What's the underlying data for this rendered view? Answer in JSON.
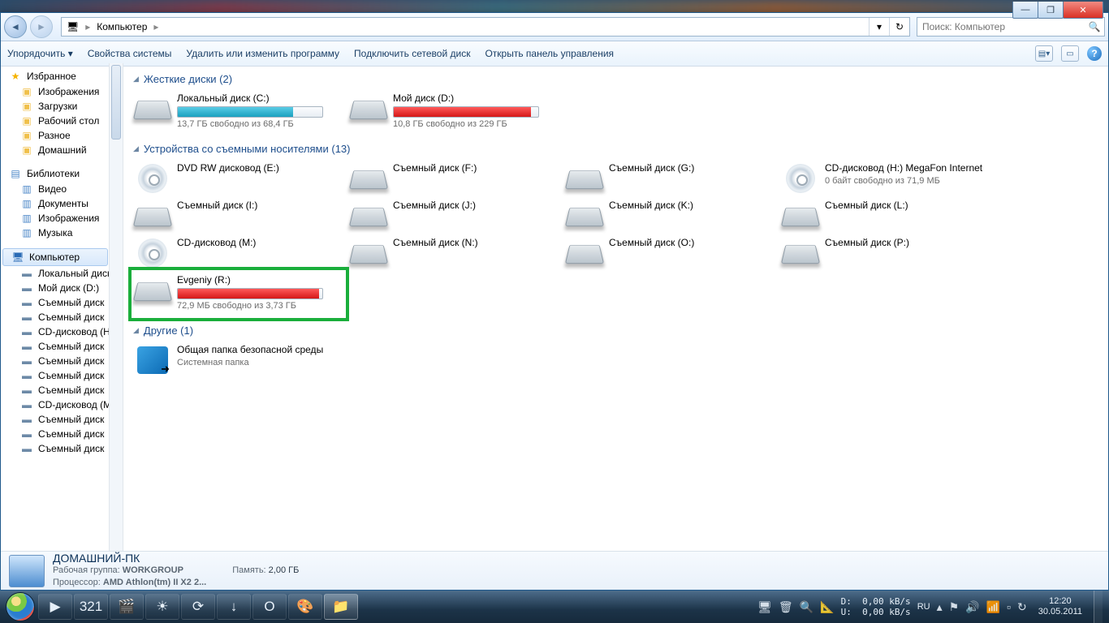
{
  "window_controls": {
    "min": "—",
    "max": "❐",
    "close": "✕"
  },
  "breadcrumb": {
    "icon": "🖥",
    "root": "Компьютер",
    "sep": "▸",
    "refresh": "↻",
    "dropdown": "▾"
  },
  "search": {
    "placeholder": "Поиск: Компьютер",
    "icon": "🔍"
  },
  "toolbar": {
    "organize": "Упорядочить ▾",
    "sysprops": "Свойства системы",
    "uninstall": "Удалить или изменить программу",
    "mapnet": "Подключить сетевой диск",
    "ctrlpanel": "Открыть панель управления",
    "viewicon": "▤▾",
    "previewicon": "▭",
    "help": "?"
  },
  "sidebar": {
    "favorites": {
      "head": "Избранное",
      "items": [
        "Изображения",
        "Загрузки",
        "Рабочий стол",
        "Разное",
        "Домашний"
      ]
    },
    "libraries": {
      "head": "Библиотеки",
      "items": [
        "Видео",
        "Документы",
        "Изображения",
        "Музыка"
      ]
    },
    "computer": {
      "head": "Компьютер",
      "items": [
        "Локальный диск",
        "Мой диск (D:)",
        "Съемный диск",
        "Съемный диск",
        "CD-дисковод (H",
        "Съемный диск",
        "Съемный диск",
        "Съемный диск",
        "Съемный диск",
        "CD-дисковод (M",
        "Съемный диск",
        "Съемный диск",
        "Съемный диск"
      ]
    }
  },
  "sections": {
    "hdd": {
      "title": "Жесткие диски (2)",
      "tri": "◢"
    },
    "removable": {
      "title": "Устройства со съемными носителями (13)",
      "tri": "◢"
    },
    "other": {
      "title": "Другие (1)",
      "tri": "◢"
    }
  },
  "hdd": [
    {
      "name": "Локальный диск (C:)",
      "space": "13,7 ГБ свободно из 68,4 ГБ",
      "fill": 80,
      "color": "teal"
    },
    {
      "name": "Мой диск (D:)",
      "space": "10,8 ГБ свободно из 229 ГБ",
      "fill": 95,
      "color": "red"
    }
  ],
  "removable": [
    {
      "name": "DVD RW дисковод (E:)",
      "type": "dvd"
    },
    {
      "name": "Съемный диск (F:)",
      "type": "hdd"
    },
    {
      "name": "Съемный диск (G:)",
      "type": "hdd"
    },
    {
      "name": "CD-дисковод (H:) MegaFon Internet",
      "type": "dvd",
      "space": "0 байт свободно из 71,9 МБ"
    },
    {
      "name": "Съемный диск (I:)",
      "type": "hdd"
    },
    {
      "name": "Съемный диск (J:)",
      "type": "hdd"
    },
    {
      "name": "Съемный диск (K:)",
      "type": "hdd"
    },
    {
      "name": "Съемный диск (L:)",
      "type": "hdd"
    },
    {
      "name": "CD-дисковод (M:)",
      "type": "dvd"
    },
    {
      "name": "Съемный диск (N:)",
      "type": "hdd"
    },
    {
      "name": "Съемный диск (O:)",
      "type": "hdd"
    },
    {
      "name": "Съемный диск (P:)",
      "type": "hdd"
    },
    {
      "name": "Evgeniy (R:)",
      "type": "hdd",
      "space": "72,9 МБ свободно из 3,73 ГБ",
      "fill": 98,
      "color": "red",
      "hl": true
    }
  ],
  "other": [
    {
      "name": "Общая папка безопасной среды",
      "sub": "Системная папка"
    }
  ],
  "details": {
    "title": "ДОМАШНИЙ-ПК",
    "wg_label": "Рабочая группа:",
    "wg_val": "WORKGROUP",
    "cpu_label": "Процессор:",
    "cpu_val": "AMD Athlon(tm) II X2 2...",
    "mem_label": "Память:",
    "mem_val": "2,00 ГБ"
  },
  "taskbar": {
    "icons": [
      "▶",
      "321",
      "🎬",
      "☀",
      "⟳",
      "↓",
      "O",
      "🎨",
      "📁"
    ],
    "net": {
      "d_label": "D:",
      "d_val": "0,00 kB/s",
      "u_label": "U:",
      "u_val": "0,00 kB/s"
    },
    "lang": "RU",
    "time": "12:20",
    "date": "30.05.2011"
  }
}
